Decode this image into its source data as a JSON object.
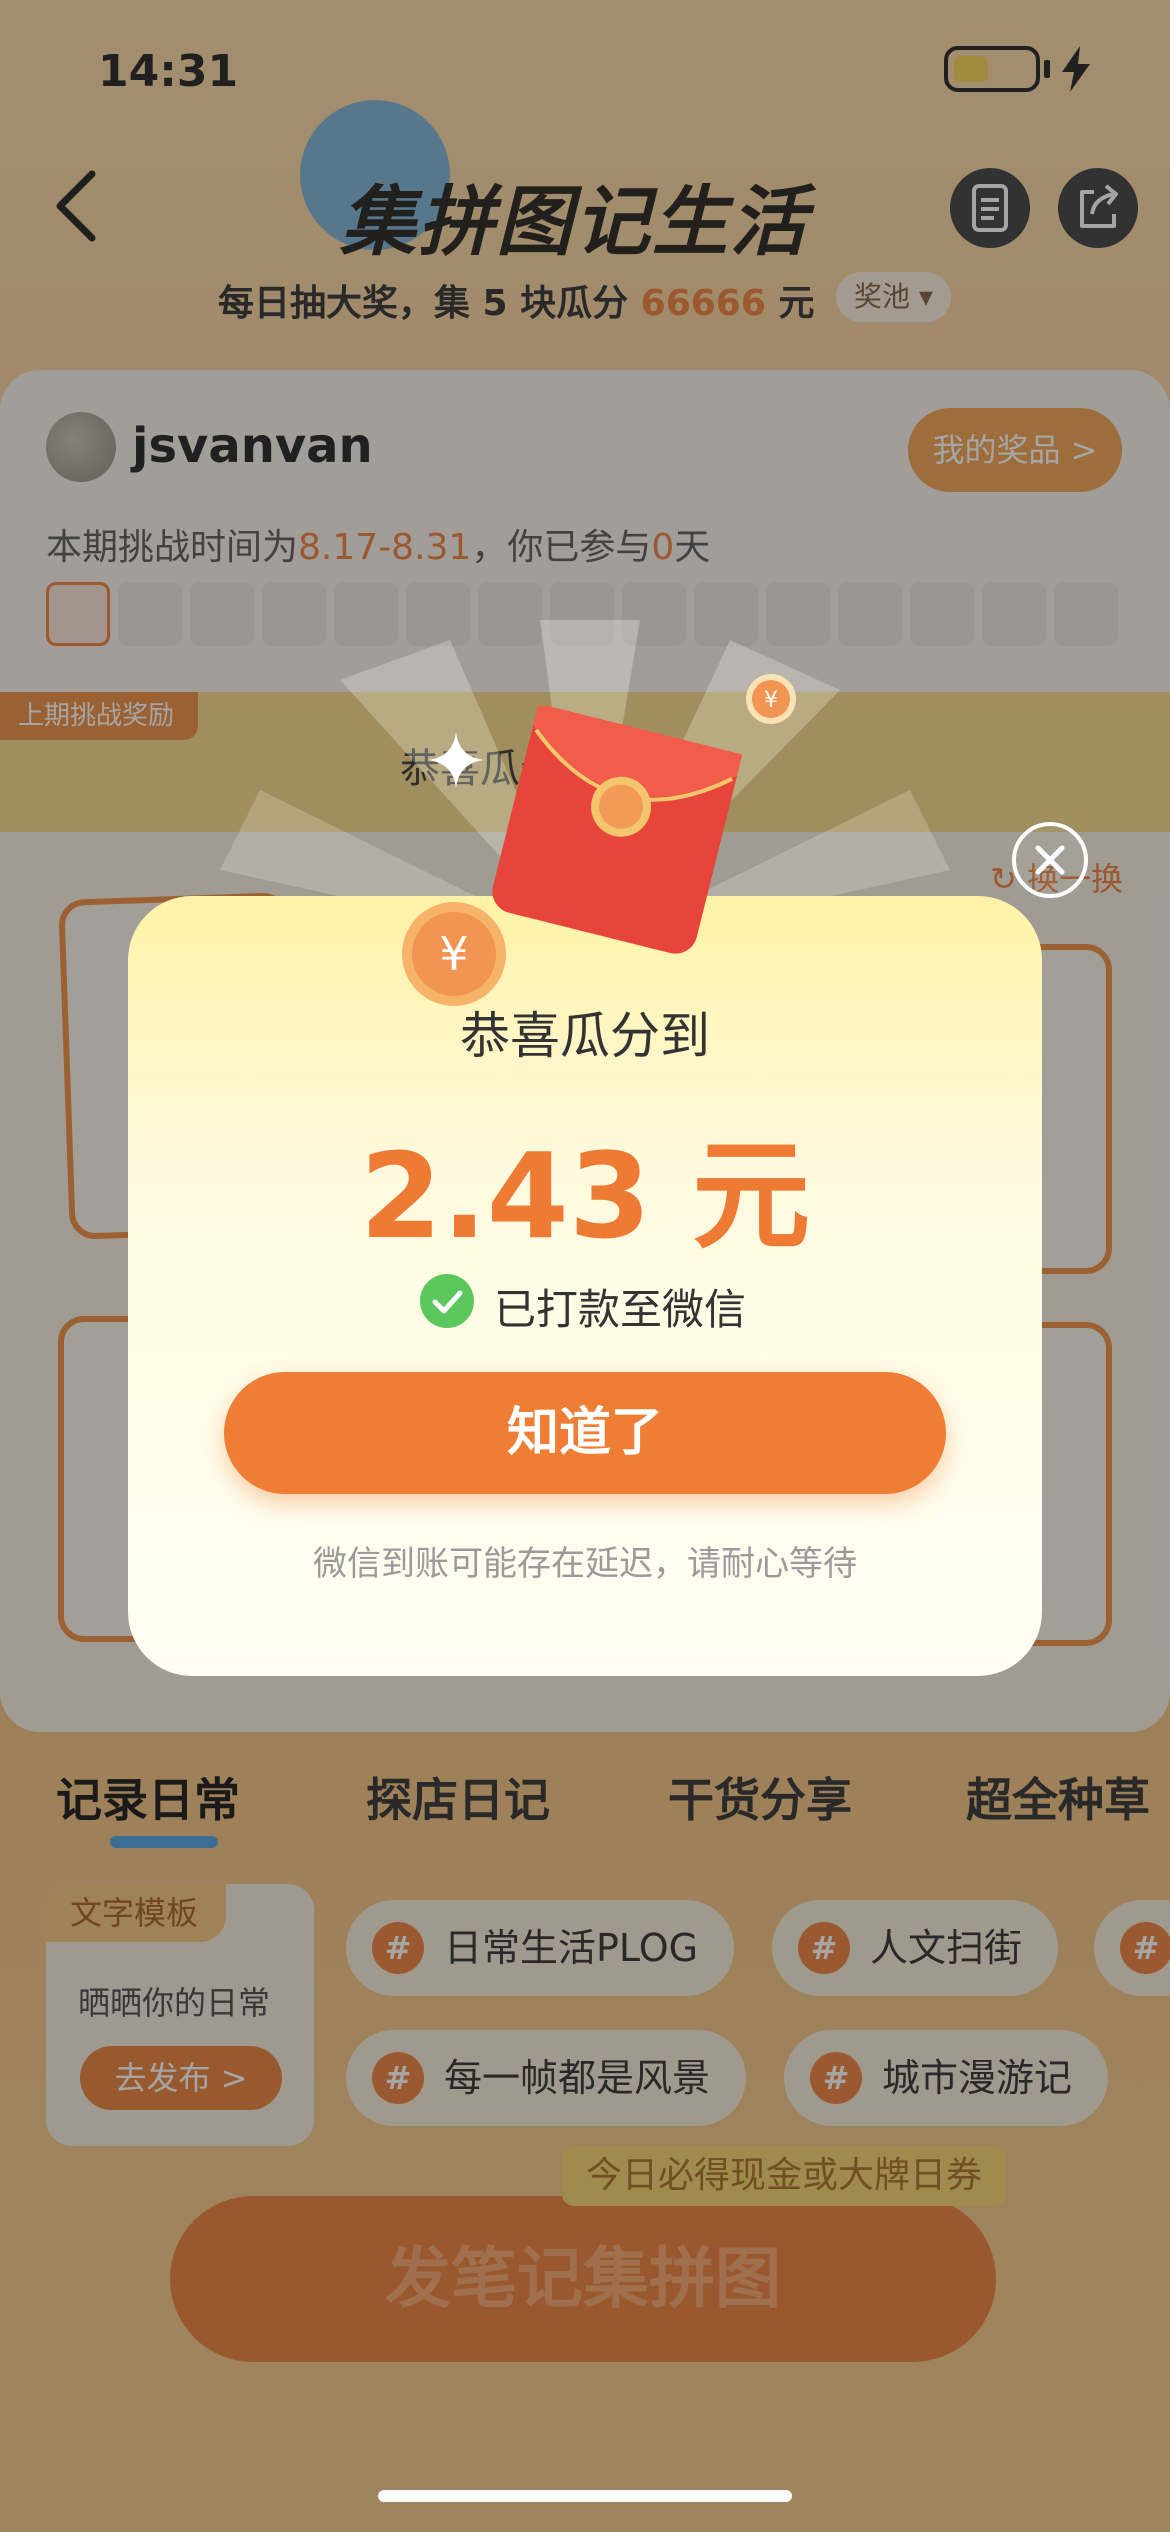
{
  "status_bar": {
    "time": "14:31"
  },
  "header": {
    "title": "集拼图记生活",
    "subtitle_prefix": "每日抽大奖，集 5 块瓜分 ",
    "subtitle_amount": "66666",
    "subtitle_suffix": " 元",
    "pool_label": "奖池"
  },
  "user": {
    "name": "jsvanvan",
    "prizes_button": "我的奖品 >",
    "challenge_prefix": "本期挑战时间为",
    "challenge_dates": "8.17-8.31",
    "challenge_middle": "，你已参与",
    "challenge_days": "0",
    "challenge_suffix": "天"
  },
  "reward": {
    "tag": "上期挑战奖励",
    "text": "恭喜瓜分到 元"
  },
  "collage": {
    "swap_label": "换一换"
  },
  "tabs": [
    {
      "label": "记录日常"
    },
    {
      "label": "探店日记"
    },
    {
      "label": "干货分享"
    },
    {
      "label": "超全种草"
    }
  ],
  "template": {
    "tag": "文字模板",
    "text": "晒晒你的日常",
    "button": "去发布 >"
  },
  "topics": [
    {
      "label": "日常生活PLOG"
    },
    {
      "label": "人文扫街"
    },
    {
      "label": "每一帧都是风景"
    },
    {
      "label": "城市漫游记"
    }
  ],
  "promo_label": "今日必得现金或大牌日券",
  "publish_button": "发笔记集拼图",
  "modal": {
    "title": "恭喜瓜分到",
    "amount": "2.43 元",
    "paid_text": "已打款至微信",
    "confirm_button": "知道了",
    "note": "微信到账可能存在延迟，请耐心等待"
  },
  "colors": {
    "accent": "#ef7a33",
    "success": "#5ac85c",
    "tab_underline": "#4a9fe0"
  }
}
